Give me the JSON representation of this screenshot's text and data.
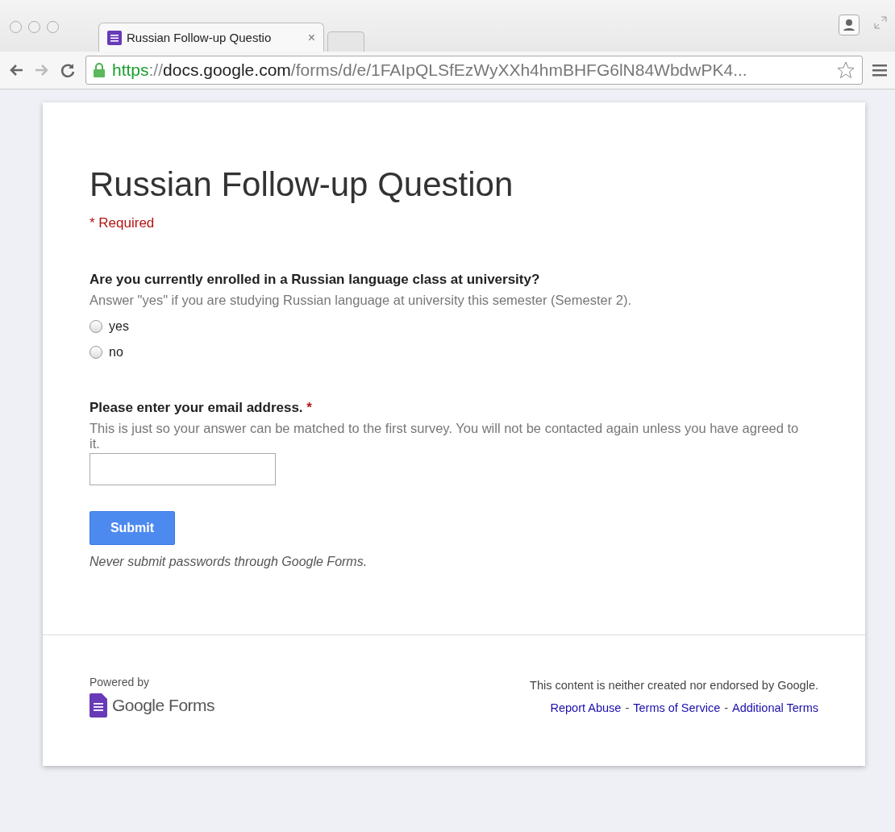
{
  "browser": {
    "tab": {
      "title": "Russian Follow-up Questio",
      "close": "×",
      "selected": true
    },
    "url": {
      "scheme": "https",
      "separator": "://",
      "host": "docs.google.com",
      "path": "/forms/d/e/1FAIpQLSfEzWyXXh4hmBHFG6lN84WbdwPK4..."
    }
  },
  "form": {
    "title": "Russian Follow-up Question",
    "required_note": "* Required",
    "questions": [
      {
        "kind": "radio",
        "title": "Are you currently enrolled in a Russian language class at university?",
        "required": false,
        "help": "Answer \"yes\" if you are studying Russian language at university this semester (Semester 2).",
        "options": [
          {
            "label": "yes",
            "selected": false
          },
          {
            "label": "no",
            "selected": false
          }
        ]
      },
      {
        "kind": "text",
        "title": "Please enter your email address.",
        "required": true,
        "help": "This is just so your answer can be matched to the first survey. You will not be contacted again unless you have agreed to it."
      }
    ],
    "required_mark": "*",
    "submit": "Submit",
    "warning": "Never submit passwords through Google Forms."
  },
  "footer": {
    "powered_by": "Powered by",
    "logo_text": "Google Forms",
    "disclaimer": "This content is neither created nor endorsed by Google.",
    "links": [
      "Report Abuse",
      "Terms of Service",
      "Additional Terms"
    ],
    "separator": "-"
  }
}
